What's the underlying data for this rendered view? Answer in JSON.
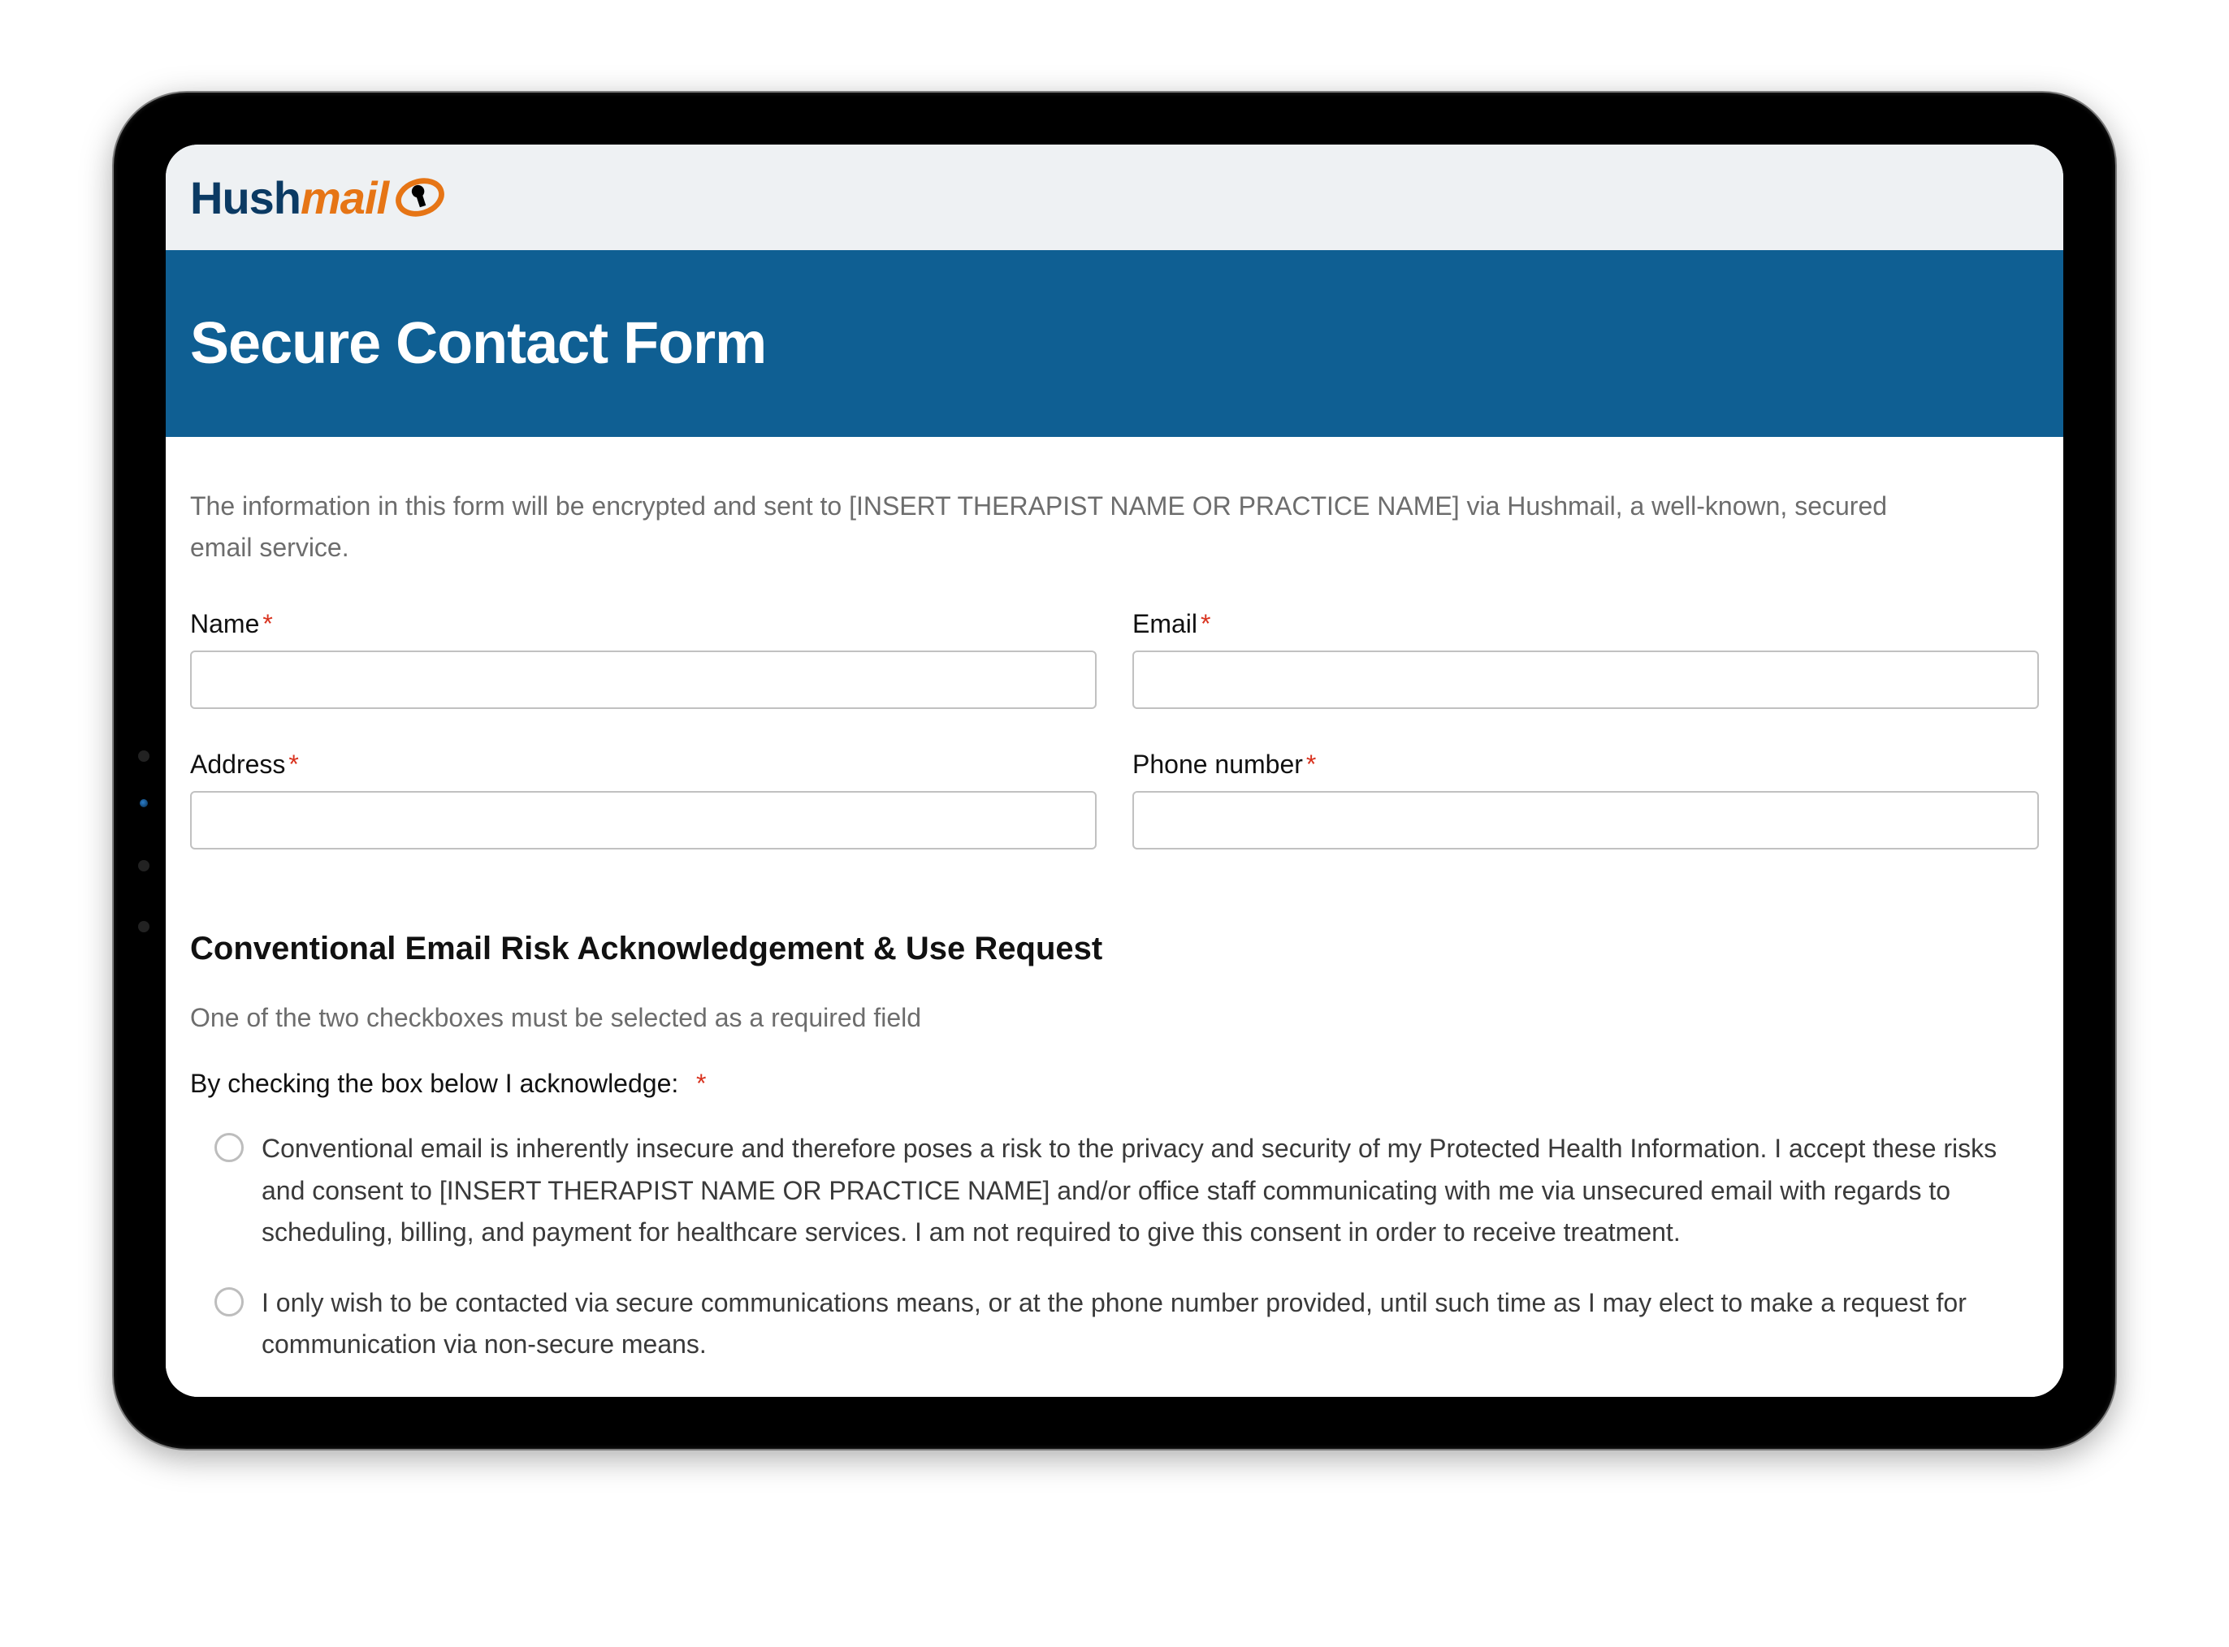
{
  "brand": {
    "part1": "Hush",
    "part2": "mail"
  },
  "header": {
    "title": "Secure Contact Form"
  },
  "intro": "The information in this form will be encrypted and sent to [INSERT THERAPIST NAME OR PRACTICE NAME] via Hushmail, a well-known, secured email service.",
  "fields": {
    "name": {
      "label": "Name",
      "value": ""
    },
    "email": {
      "label": "Email",
      "value": ""
    },
    "address": {
      "label": "Address",
      "value": ""
    },
    "phone": {
      "label": "Phone number",
      "value": ""
    }
  },
  "required_mark": "*",
  "section": {
    "title": "Conventional Email Risk Acknowledgement & Use Request",
    "note": "One of the two checkboxes must be selected as a required field",
    "ack_label": "By checking the box below I acknowledge:",
    "options": [
      "Conventional email is inherently insecure and therefore poses a risk to the privacy and security of my Protected Health Information. I accept these risks and consent to [INSERT THERAPIST NAME OR PRACTICE NAME] and/or office staff communicating with me via unsecured email with regards to scheduling, billing, and payment for healthcare services. I am not required to give this consent in order to receive treatment.",
      "I only wish to be contacted via secure communications means, or at the phone number provided, until such time as I may elect to make a request for communication via non-secure means."
    ]
  },
  "colors": {
    "header_bg": "#0f5f93",
    "topbar_bg": "#eef1f3",
    "brand_blue": "#0b3a63",
    "brand_orange": "#e67515",
    "required": "#d9331f"
  }
}
